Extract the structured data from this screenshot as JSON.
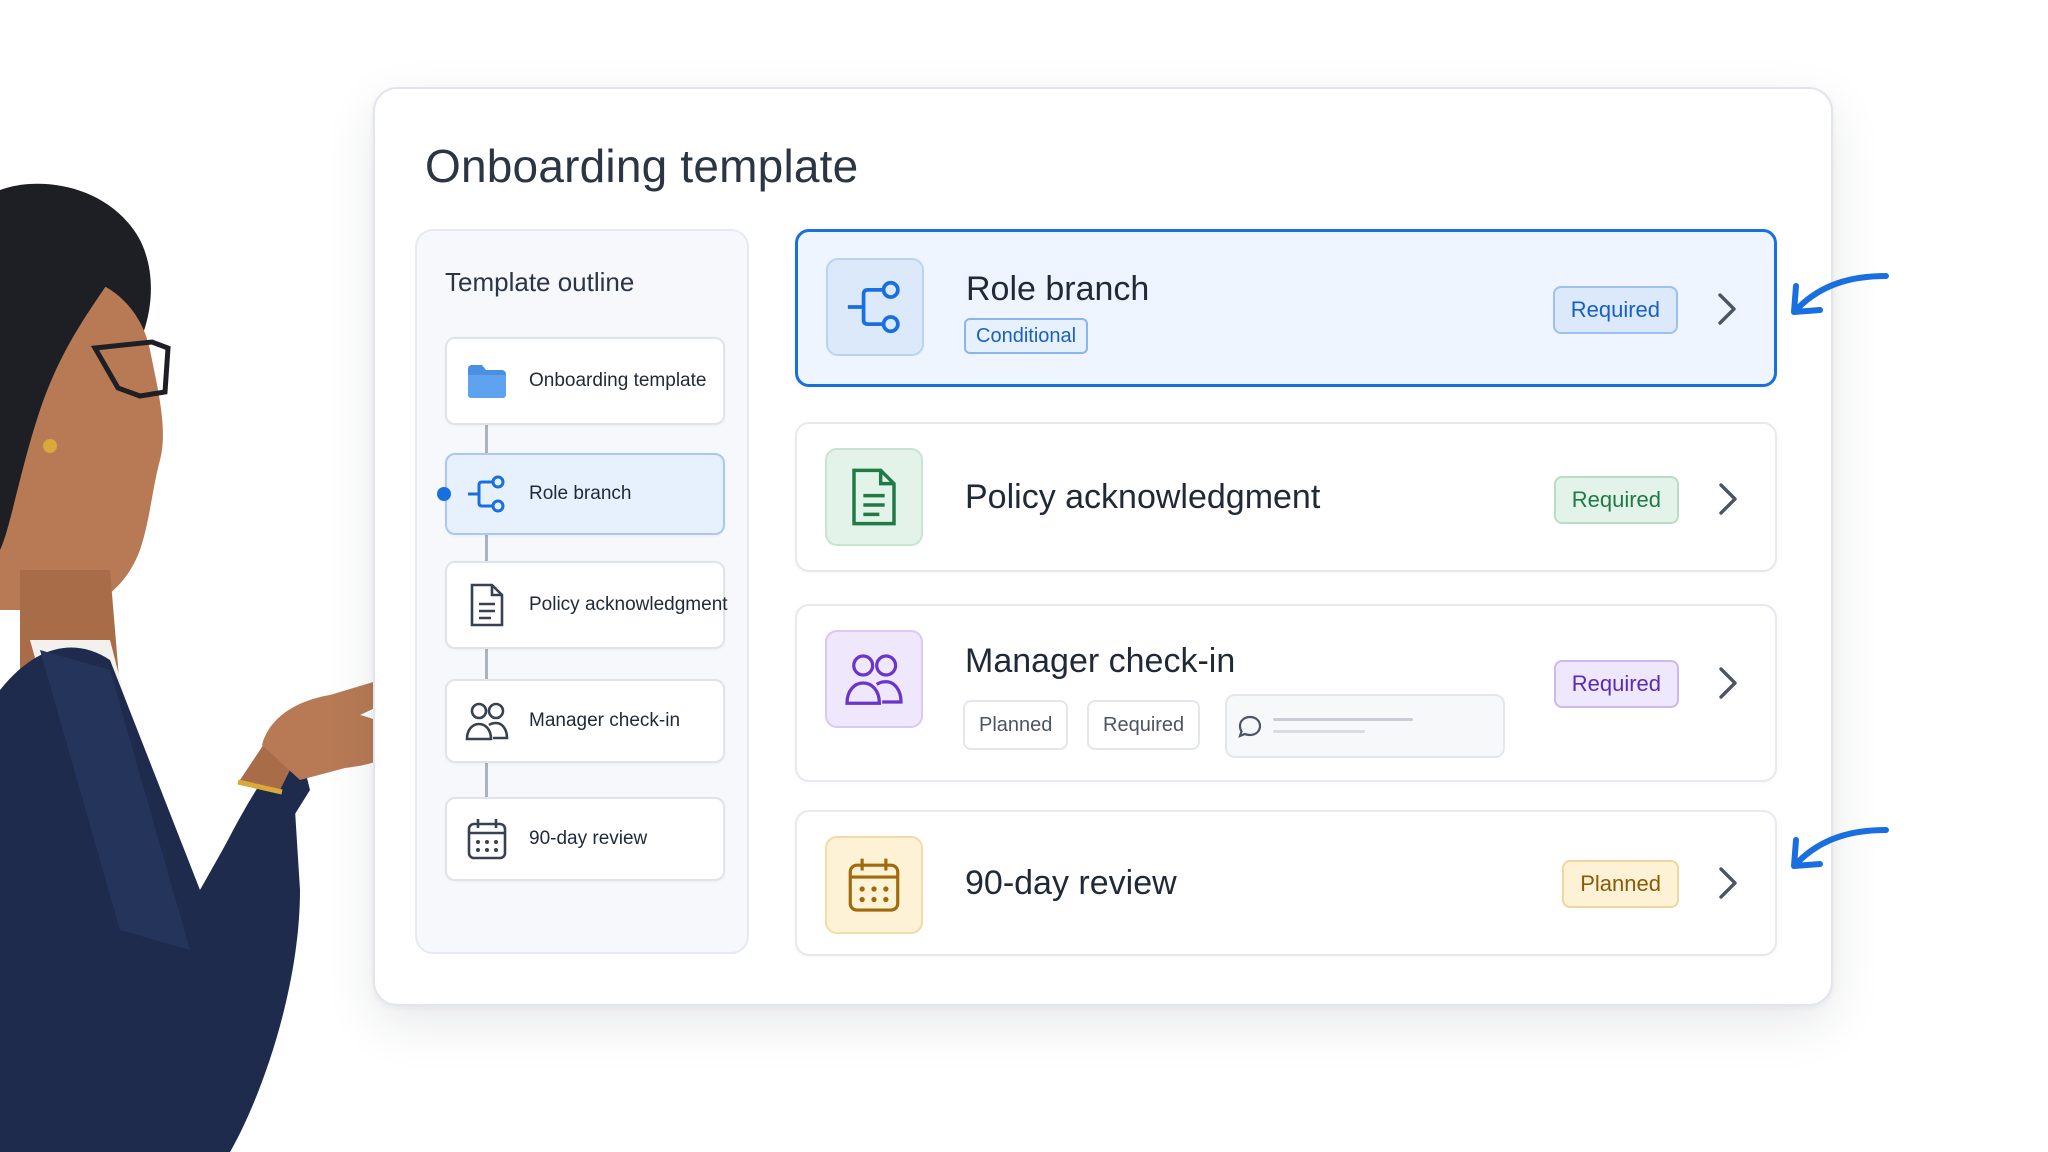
{
  "page": {
    "title": "Onboarding template"
  },
  "outline": {
    "title": "Template outline",
    "items": [
      {
        "label": "Onboarding template",
        "icon": "folder-icon"
      },
      {
        "label": "Role branch",
        "icon": "branch-icon",
        "active": true
      },
      {
        "label": "Policy acknowledgment",
        "icon": "document-icon"
      },
      {
        "label": "Manager check-in",
        "icon": "people-icon"
      },
      {
        "label": "90-day review",
        "icon": "calendar-icon"
      }
    ]
  },
  "steps": [
    {
      "title": "Role branch",
      "status": "Required",
      "tag": "Conditional",
      "icon": "branch-icon",
      "accent": "#1a6fe0"
    },
    {
      "title": "Policy acknowledgment",
      "status": "Required",
      "icon": "document-icon",
      "accent": "#1f7a45"
    },
    {
      "title": "Manager check-in",
      "status": "Required",
      "icon": "people-icon",
      "accent": "#6a35c9",
      "chips": [
        "Planned",
        "Required"
      ]
    },
    {
      "title": "90-day review",
      "status": "Planned",
      "icon": "calendar-icon",
      "accent": "#a06a0c"
    }
  ],
  "colors": {
    "primary": "#1a6fe0",
    "green": "#1f7a45",
    "purple": "#6a35c9",
    "amber": "#a06a0c"
  }
}
